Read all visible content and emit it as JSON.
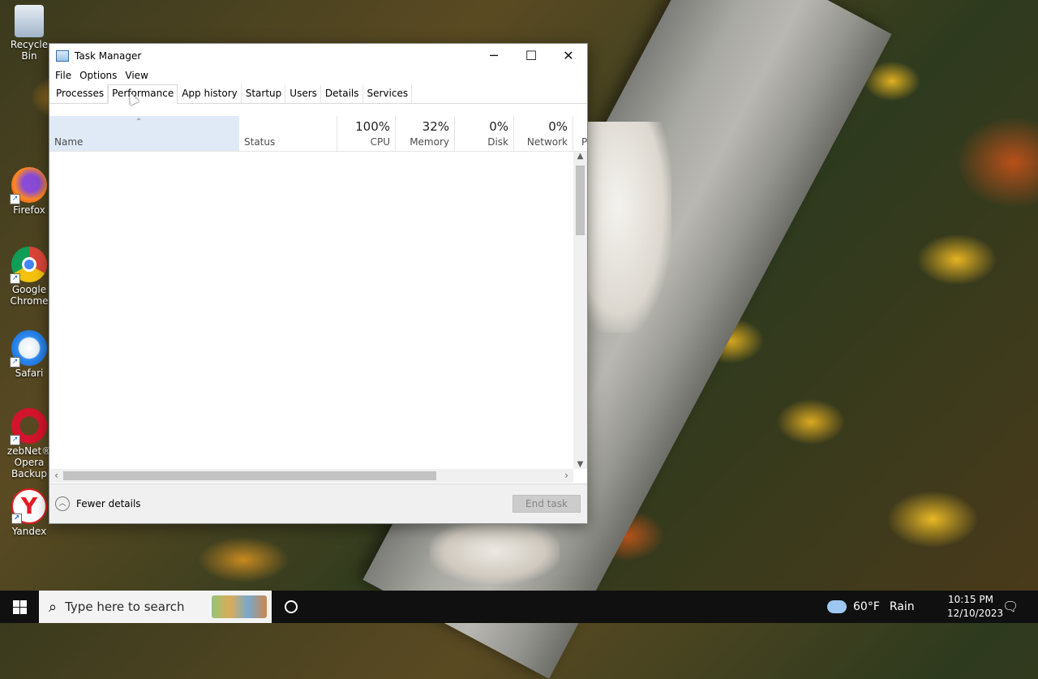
{
  "desktop": {
    "icons": [
      {
        "label": "Recycle Bin"
      },
      {
        "label": "Firefox"
      },
      {
        "label": "Google Chrome"
      },
      {
        "label": "Safari"
      },
      {
        "label": "zebNet® Opera Backup"
      },
      {
        "label": "Yandex"
      }
    ]
  },
  "window": {
    "title": "Task Manager",
    "controls": {
      "minimize": "─",
      "maximize": "☐",
      "close": "✕"
    },
    "menu": [
      "File",
      "Options",
      "View"
    ],
    "tabs": [
      "Processes",
      "Performance",
      "App history",
      "Startup",
      "Users",
      "Details",
      "Services"
    ],
    "active_tab": "Performance",
    "columns": {
      "name": {
        "label": "Name"
      },
      "status": {
        "label": "Status"
      },
      "cpu": {
        "pct": "100%",
        "label": "CPU"
      },
      "memory": {
        "pct": "32%",
        "label": "Memory"
      },
      "disk": {
        "pct": "0%",
        "label": "Disk"
      },
      "network": {
        "pct": "0%",
        "label": "Network"
      },
      "power": {
        "label": "P"
      }
    },
    "footer": {
      "fewer_details": "Fewer details",
      "end_task": "End task"
    }
  },
  "taskbar": {
    "search_placeholder": "Type here to search",
    "weather": {
      "temp": "60°F",
      "condition": "Rain"
    },
    "clock": {
      "time": "10:15 PM",
      "date": "12/10/2023"
    }
  }
}
